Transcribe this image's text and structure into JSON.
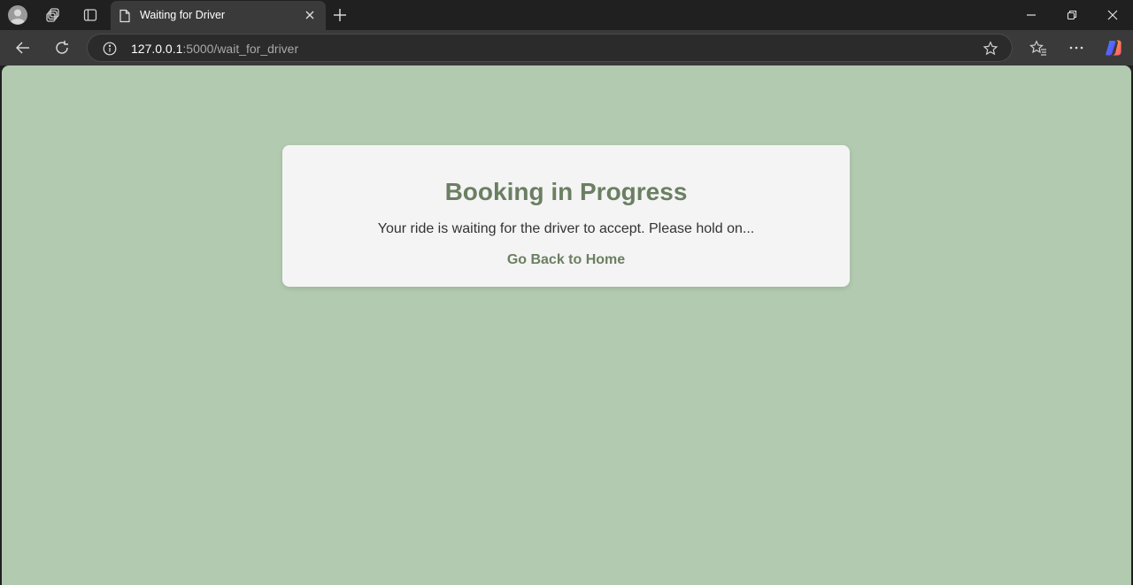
{
  "browser": {
    "tab": {
      "title": "Waiting for Driver"
    },
    "address": {
      "host": "127.0.0.1",
      "rest": ":5000/wait_for_driver"
    },
    "icons": {
      "profile": "profile-avatar-icon",
      "workspaces": "workspaces-icon",
      "tab_actions": "tab-actions-icon",
      "page": "page-icon",
      "close": "close-icon",
      "new_tab": "plus-icon",
      "minimize": "minimize-icon",
      "restore": "restore-icon",
      "close_window": "close-window-icon",
      "back": "back-arrow-icon",
      "refresh": "refresh-icon",
      "info": "info-icon",
      "favorite": "star-icon",
      "favorites": "favorites-icon",
      "more": "more-icon",
      "copilot": "copilot-icon"
    }
  },
  "page": {
    "background": "#b2cab0",
    "card": {
      "heading": "Booking in Progress",
      "message": "Your ride is waiting for the driver to accept. Please hold on...",
      "link": "Go Back to Home"
    },
    "accent": "#6b7f62"
  }
}
